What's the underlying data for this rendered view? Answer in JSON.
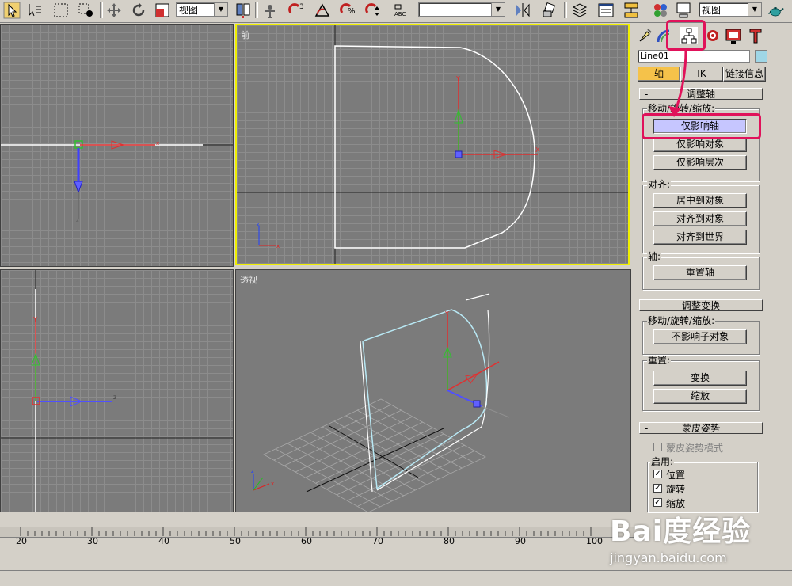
{
  "toolbar": {
    "view_select_1": "视图",
    "view_select_2": "视图",
    "abc_label": "ABC"
  },
  "viewports": {
    "top_left_label": "",
    "front_label": "前",
    "left_label": "",
    "perspective_label": "透视"
  },
  "panel": {
    "object_name": "Line01",
    "object_color": "#9fd6e6",
    "tabs": {
      "pivot": "轴",
      "ik": "IK",
      "link_info": "链接信息"
    },
    "adjust_pivot": {
      "title": "调整轴",
      "collapse": "-",
      "move_rotate_scale_label": "移动/旋转/缩放:",
      "affect_pivot_only": "仅影响轴",
      "affect_object_only": "仅影响对象",
      "affect_hierarchy_only": "仅影响层次",
      "align_label": "对齐:",
      "center_to_object": "居中到对象",
      "align_to_object": "对齐到对象",
      "align_to_world": "对齐到世界",
      "pivot_label": "轴:",
      "reset_pivot": "重置轴"
    },
    "adjust_transform": {
      "title": "调整变换",
      "collapse": "-",
      "move_rotate_scale_label": "移动/旋转/缩放:",
      "dont_affect_children": "不影响子对象",
      "reset_label": "重置:",
      "transform": "变换",
      "scale": "缩放"
    },
    "skin_pose": {
      "title": "蒙皮姿势",
      "collapse": "-",
      "skin_pose_mode": "蒙皮姿势模式",
      "enabled_label": "启用:",
      "position": "位置",
      "rotation": "旋转",
      "scale": "缩放",
      "position_checked": true,
      "rotation_checked": true,
      "scale_checked": true
    }
  },
  "timeline": {
    "ticks": [
      "20",
      "30",
      "40",
      "50",
      "60",
      "70",
      "80",
      "90",
      "100"
    ]
  },
  "watermark": {
    "brand": "Bai度经验",
    "url": "jingyan.baidu.com"
  },
  "colors": {
    "highlight": "#e0125a",
    "viewport_active_border": "#f0f000",
    "pressed_button": "#c6c6ff",
    "active_tab": "#f5c24a"
  }
}
